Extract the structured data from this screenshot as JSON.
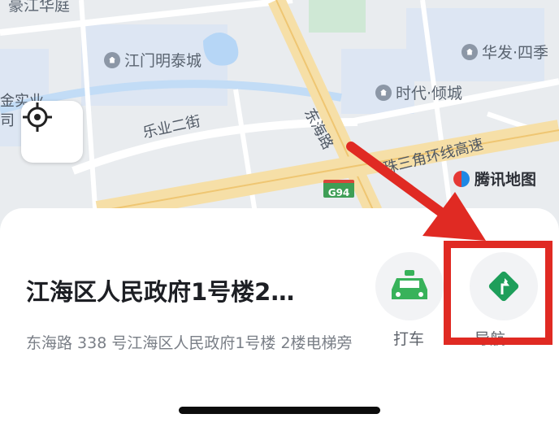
{
  "map": {
    "poi": [
      {
        "name": "豪江华庭"
      },
      {
        "name": "江门明泰城"
      },
      {
        "name": "华发·四季"
      },
      {
        "name": "时代·倾城"
      },
      {
        "name": "金实业"
      },
      {
        "name": "司"
      }
    ],
    "roads": {
      "east": "东海路",
      "leye": "乐业二街",
      "highway": "珠三角环线高速",
      "shield": "G94"
    },
    "brand": "腾讯地图",
    "icons": {
      "locate": "locate-crosshair-icon",
      "brand": "tencent-map-logo-icon"
    }
  },
  "sheet": {
    "title": "江海区人民政府1号楼2…",
    "address": "东海路 338 号江海区人民政府1号楼 2楼电梯旁",
    "taxi": {
      "label": "打车",
      "icon": "taxi-icon",
      "color": "#38b25a"
    },
    "navigation": {
      "label": "导航",
      "icon": "navigation-diamond-icon",
      "color": "#1e9e5a"
    }
  },
  "annotation": {
    "color": "#e02a23"
  }
}
